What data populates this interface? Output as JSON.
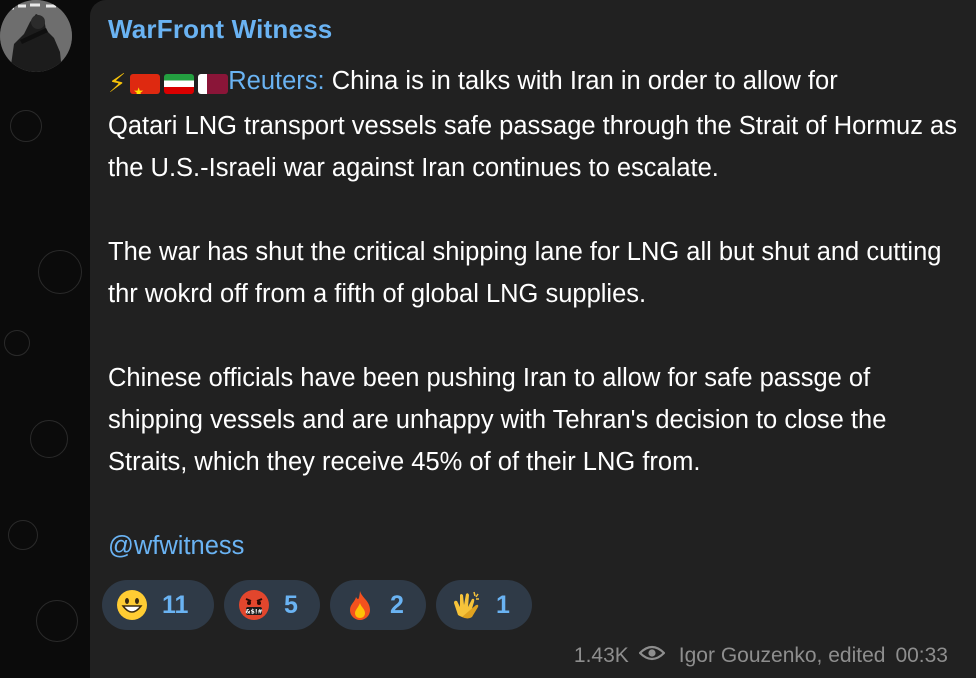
{
  "channel": {
    "name": "WarFront Witness",
    "avatar": "soldier-avatar"
  },
  "message": {
    "lead_icons": [
      "lightning-icon",
      "china-flag-icon",
      "iran-flag-icon",
      "qatar-flag-icon"
    ],
    "source_label": "Reuters:",
    "line1_rest": " China is in talks with Iran in order to allow for",
    "paragraph1_rest": "Qatari LNG transport vessels safe passage through the Strait of Hormuz as the U.S.-Israeli war against Iran continues to escalate.",
    "paragraph2": "The war has shut the critical shipping lane for LNG all but shut and cutting thr wokrd off from a fifth of global LNG supplies.",
    "paragraph3": "Chinese officials have been pushing Iran to allow for safe passge of shipping vessels and are unhappy with Tehran's decision to close the Straits, which they receive 45% of of their LNG from.",
    "handle": "@wfwitness"
  },
  "reactions": [
    {
      "icon": "grinning-face-icon",
      "count": "11"
    },
    {
      "icon": "cursing-face-icon",
      "count": "5"
    },
    {
      "icon": "fire-icon",
      "count": "2"
    },
    {
      "icon": "clapping-hands-icon",
      "count": "1"
    }
  ],
  "footer": {
    "views": "1.43K",
    "view_icon": "eye-icon",
    "author": "Igor Gouzenko, edited",
    "time": "00:33"
  },
  "colors": {
    "link": "#6ab3f3",
    "bubble": "#212121",
    "reaction_bg": "#2f3a47",
    "meta_text": "#8e8e8e"
  }
}
